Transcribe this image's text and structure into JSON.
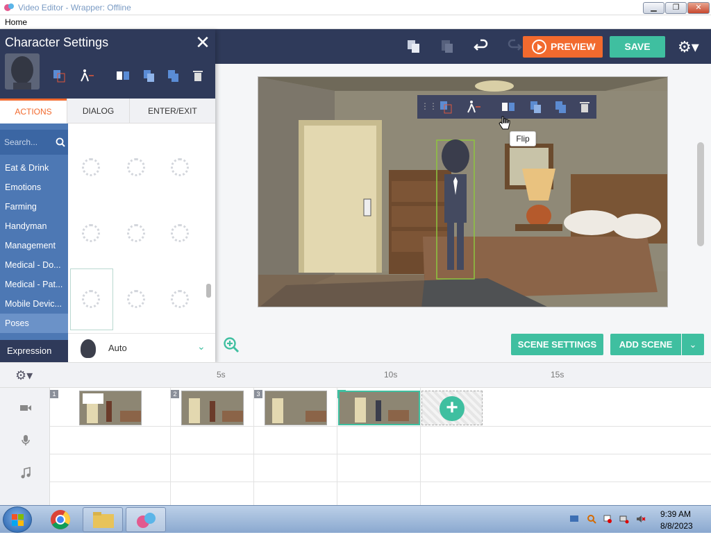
{
  "window": {
    "title": "Video Editor - Wrapper: Offline",
    "min_label": "▁",
    "max_label": "❐",
    "close_label": "✕"
  },
  "menubar": {
    "home": "Home"
  },
  "toolbar": {
    "preview": "PREVIEW",
    "save": "SAVE",
    "gear": "⚙▾"
  },
  "char_panel": {
    "title": "Character Settings",
    "close": "✕",
    "tabs": {
      "actions": "ACTIONS",
      "dialog": "DIALOG",
      "enter_exit": "ENTER/EXIT"
    },
    "search_placeholder": "Search...",
    "categories": [
      "Eat & Drink",
      "Emotions",
      "Farming",
      "Handyman",
      "Management",
      "Medical - Do...",
      "Medical - Pat...",
      "Mobile Devic...",
      "Poses"
    ],
    "expression_label": "Expression",
    "expression_value": "Auto",
    "expression_chevron": "⌄"
  },
  "stage": {
    "tooltip": "Flip"
  },
  "buttons": {
    "scene_settings": "SCENE SETTINGS",
    "add_scene": "ADD SCENE",
    "add_scene_dropdown": "⌄"
  },
  "timeline": {
    "gear": "⚙▾",
    "ticks": [
      "5s",
      "10s",
      "15s"
    ],
    "scenes": [
      "1",
      "2",
      "3",
      "4"
    ],
    "add_symbol": "+"
  },
  "taskbar": {
    "time": "9:39 AM",
    "date": "8/8/2023"
  },
  "colors": {
    "navy": "#2f3a5a",
    "orange": "#f26a2e",
    "teal": "#3fbfa0",
    "blue": "#4d78b4"
  }
}
